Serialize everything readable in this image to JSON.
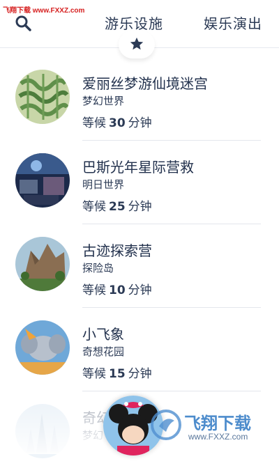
{
  "watermark": {
    "top_text": "飞翔下载 www.FXXZ.com",
    "brand_text": "飞翔下载",
    "brand_url": "www.FXXZ.com"
  },
  "header": {
    "tabs": [
      {
        "label": "游乐设施",
        "active": true
      },
      {
        "label": "娱乐演出",
        "active": false
      }
    ],
    "search_icon": "search-icon",
    "favorite_icon": "star-icon"
  },
  "attractions": [
    {
      "title": "爱丽丝梦游仙境迷宫",
      "area": "梦幻世界",
      "wait_prefix": "等候",
      "wait_minutes": "30",
      "wait_unit": "分钟"
    },
    {
      "title": "巴斯光年星际营救",
      "area": "明日世界",
      "wait_prefix": "等候",
      "wait_minutes": "25",
      "wait_unit": "分钟"
    },
    {
      "title": "古迹探索营",
      "area": "探险岛",
      "wait_prefix": "等候",
      "wait_minutes": "10",
      "wait_unit": "分钟"
    },
    {
      "title": "小飞象",
      "area": "奇想花园",
      "wait_prefix": "等候",
      "wait_minutes": "15",
      "wait_unit": "分钟"
    },
    {
      "title": "奇幻",
      "area": "梦幻"
    }
  ],
  "colors": {
    "text": "#2b3a55",
    "accent": "#2b3a55",
    "divider": "#e3e6ec"
  }
}
